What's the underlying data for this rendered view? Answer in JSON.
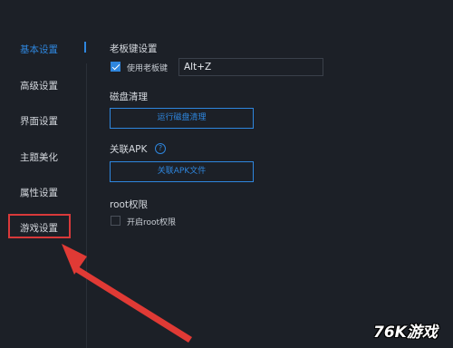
{
  "sidebar": {
    "items": [
      {
        "label": "基本设置",
        "active": true
      },
      {
        "label": "高级设置",
        "active": false
      },
      {
        "label": "界面设置",
        "active": false
      },
      {
        "label": "主题美化",
        "active": false
      },
      {
        "label": "属性设置",
        "active": false
      },
      {
        "label": "游戏设置",
        "active": false,
        "highlighted": true
      }
    ]
  },
  "boss_key": {
    "title": "老板键设置",
    "checkbox_label": "使用老板键",
    "checked": true,
    "hotkey_value": "Alt+Z"
  },
  "disk_cleanup": {
    "title": "磁盘清理",
    "button_label": "运行磁盘清理"
  },
  "apk": {
    "title": "关联APK",
    "help_glyph": "?",
    "button_label": "关联APK文件"
  },
  "root": {
    "title": "root权限",
    "checkbox_label": "开启root权限",
    "checked": false
  },
  "watermark": "76K游戏",
  "colors": {
    "background": "#1c2027",
    "accent": "#2e86de",
    "highlight": "#d8393a",
    "text": "#d4d8de"
  }
}
